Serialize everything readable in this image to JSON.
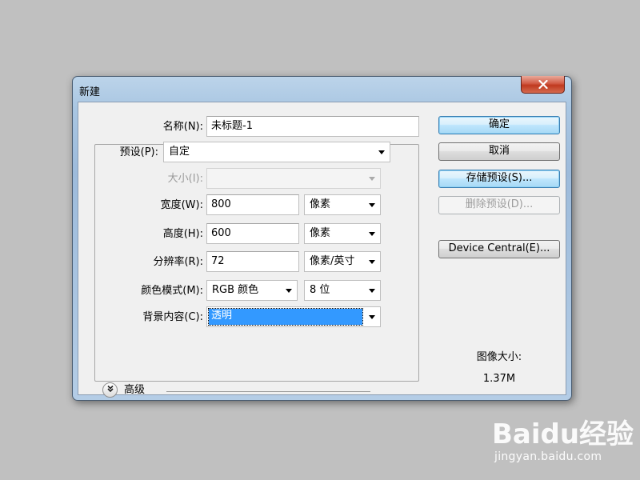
{
  "dialog": {
    "title": "新建",
    "name_label": "名称(N):",
    "name_value": "未标题-1",
    "preset_label": "预设(P):",
    "preset_value": "自定",
    "size_label": "大小(I):",
    "size_value": "",
    "width_label": "宽度(W):",
    "width_value": "800",
    "width_unit": "像素",
    "height_label": "高度(H):",
    "height_value": "600",
    "height_unit": "像素",
    "resolution_label": "分辨率(R):",
    "resolution_value": "72",
    "resolution_unit": "像素/英寸",
    "color_mode_label": "颜色模式(M):",
    "color_mode_value": "RGB 颜色",
    "bit_depth_value": "8 位",
    "background_label": "背景内容(C):",
    "background_value": "透明",
    "advanced_label": "高级",
    "image_size_label": "图像大小:",
    "image_size_value": "1.37M"
  },
  "buttons": {
    "ok": "确定",
    "cancel": "取消",
    "save_preset": "存储预设(S)...",
    "delete_preset": "删除预设(D)...",
    "device_central": "Device Central(E)..."
  },
  "watermark": {
    "logo": "Baidu经验",
    "url": "jingyan.baidu.com"
  },
  "icons": {
    "close": "close-icon",
    "advanced": "double-chevron-down-icon",
    "dropdown": "dropdown-arrow-icon"
  },
  "colors": {
    "selection": "#3399ff",
    "default_button_border": "#3c7fb1",
    "close_button": "#c0391f"
  }
}
